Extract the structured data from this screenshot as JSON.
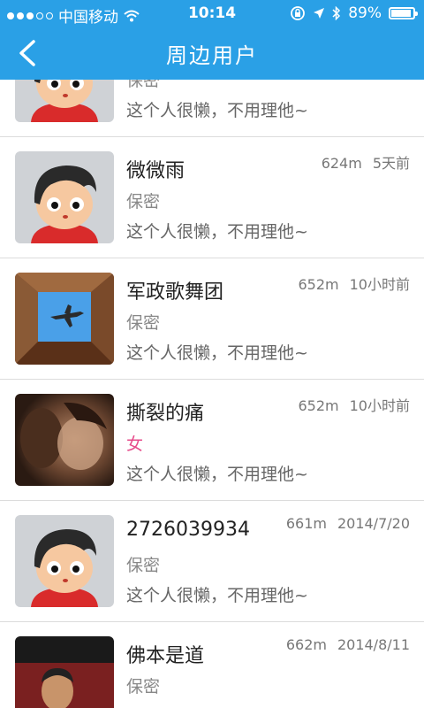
{
  "statusbar": {
    "carrier": "中国移动",
    "time": "10:14",
    "battery": "89%"
  },
  "navbar": {
    "title": "周边用户",
    "back_icon": "chevron-left-icon"
  },
  "users": [
    {
      "name": "",
      "gender": "保密",
      "signature": "这个人很懒，不用理他~",
      "distance": "",
      "time": "",
      "avatar": "cartoon-boy"
    },
    {
      "name": "微微雨",
      "gender": "保密",
      "signature": "这个人很懒，不用理他~",
      "distance": "624m",
      "time": "5天前",
      "avatar": "cartoon-boy"
    },
    {
      "name": "军政歌舞团",
      "gender": "保密",
      "signature": "这个人很懒，不用理他~",
      "distance": "652m",
      "time": "10小时前",
      "avatar": "airplane-photo"
    },
    {
      "name": "撕裂的痛",
      "gender": "女",
      "signature": "这个人很懒，不用理他~",
      "distance": "652m",
      "time": "10小时前",
      "avatar": "couple-photo"
    },
    {
      "name": "2726039934",
      "gender": "保密",
      "signature": "这个人很懒，不用理他~",
      "distance": "661m",
      "time": "2014/7/20",
      "avatar": "cartoon-boy"
    },
    {
      "name": "佛本是道",
      "gender": "保密",
      "signature": "",
      "distance": "662m",
      "time": "2014/8/11",
      "avatar": "man-photo"
    }
  ],
  "colors": {
    "primary": "#2aa0e6",
    "female": "#e64a8a"
  }
}
